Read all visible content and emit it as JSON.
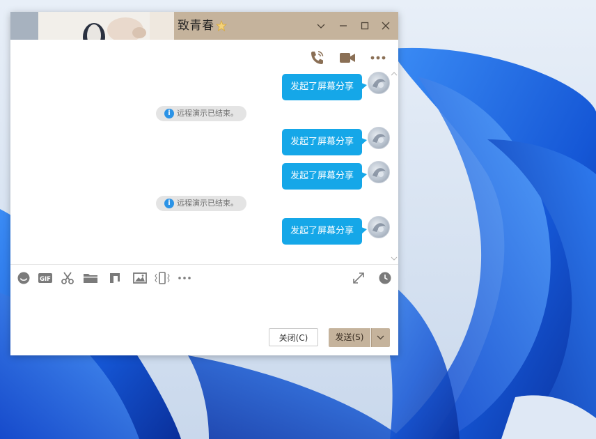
{
  "window": {
    "contact_name": "致青春",
    "vip_badge_icon": "star-badge-icon",
    "controls": [
      "minimize-dropdown-icon",
      "minimize-icon",
      "maximize-icon",
      "close-icon"
    ]
  },
  "call_toolbar": [
    "voice-call-icon",
    "video-call-icon",
    "more-options-icon"
  ],
  "messages": [
    {
      "type": "outgoing",
      "text": "发起了屏幕分享"
    },
    {
      "type": "system",
      "text": "远程演示已结束。"
    },
    {
      "type": "outgoing",
      "text": "发起了屏幕分享"
    },
    {
      "type": "outgoing",
      "text": "发起了屏幕分享"
    },
    {
      "type": "system",
      "text": "远程演示已结束。"
    },
    {
      "type": "outgoing",
      "text": "发起了屏幕分享"
    }
  ],
  "input_toolbar": [
    "emoji-icon",
    "gif-icon",
    "screenshot-scissors-icon",
    "folder-icon",
    "music-icon",
    "image-icon",
    "shake-window-icon",
    "more-icon",
    "expand-icon",
    "history-clock-icon"
  ],
  "input": {
    "value": "",
    "placeholder": ""
  },
  "buttons": {
    "close_label": "关闭(C)",
    "send_label": "发送(S)"
  },
  "colors": {
    "titlebar": "#c5b39c",
    "bubble": "#15a7e8",
    "send_button": "#c5b39c",
    "icon_brown": "#8a6f55",
    "wallpaper_blue": "#1a5ee0"
  }
}
